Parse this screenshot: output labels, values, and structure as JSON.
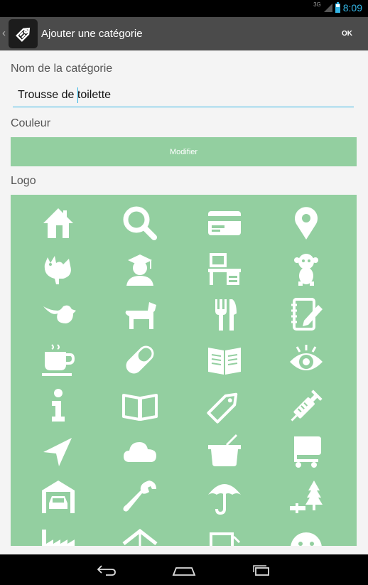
{
  "status_bar": {
    "network": "3G",
    "time": "8:09"
  },
  "action_bar": {
    "title": "Ajouter une catégorie",
    "ok_label": "OK",
    "app_icon": "tag-icon"
  },
  "form": {
    "name_label": "Nom de la catégorie",
    "name_value": "Trousse de toilette",
    "color_label": "Couleur",
    "modify_label": "Modifier",
    "logo_label": "Logo",
    "color_value": "#93cfa0"
  },
  "logo_icons": [
    [
      "house-icon",
      "search-icon",
      "credit-card-icon",
      "map-pin-icon"
    ],
    [
      "rooster-icon",
      "graduate-icon",
      "desk-icon",
      "monkey-icon"
    ],
    [
      "bird-icon",
      "dog-icon",
      "fork-knife-icon",
      "notebook-pencil-icon"
    ],
    [
      "coffee-cup-icon",
      "pill-icon",
      "open-book-icon",
      "eye-icon"
    ],
    [
      "info-icon",
      "book-outline-icon",
      "tag-outline-icon",
      "syringe-icon"
    ],
    [
      "navigation-arrow-icon",
      "cloud-icon",
      "cooking-pot-icon",
      "cart-icon"
    ],
    [
      "garage-car-icon",
      "wrench-icon",
      "umbrella-icon",
      "saw-tree-icon"
    ],
    [
      "factory-icon",
      "tent-icon",
      "screen-icon",
      "face-icon"
    ]
  ],
  "nav_bar": {
    "back": "back-icon",
    "home": "home-icon",
    "recents": "recent-apps-icon"
  }
}
